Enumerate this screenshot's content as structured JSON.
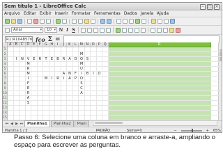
{
  "window": {
    "title": "Sem título 1 - LibreOffice Calc"
  },
  "menu": [
    "Arquivo",
    "Editar",
    "Exibir",
    "Inserir",
    "Formatar",
    "Ferramentas",
    "Dados",
    "Janela",
    "Ajuda"
  ],
  "formatting": {
    "font_name": "Arial",
    "font_size": "10",
    "bold": "N",
    "italic": "I",
    "underline": "S"
  },
  "formula_bar": {
    "name_box": "R1:R1048576",
    "function_wizard": "fco",
    "sum": "Σ",
    "equals": "="
  },
  "grid": {
    "columns": [
      "A",
      "B",
      "C",
      "D",
      "E",
      "F",
      "G",
      "H",
      "I",
      "J",
      "K",
      "L",
      "M",
      "N",
      "O",
      "P",
      "Q"
    ],
    "selected_column": "R",
    "rows": [
      "1",
      "2",
      "3",
      "4",
      "5",
      "6",
      "7",
      "8",
      "9",
      "10",
      "11",
      "12",
      "13",
      "14",
      "15"
    ],
    "cells": [
      {
        "row": "2",
        "col": "M",
        "text": "M"
      },
      {
        "row": "3",
        "col": "B",
        "text": "I"
      },
      {
        "row": "3",
        "col": "C",
        "text": "N"
      },
      {
        "row": "3",
        "col": "D",
        "text": "V"
      },
      {
        "row": "3",
        "col": "E",
        "text": "E"
      },
      {
        "row": "3",
        "col": "F",
        "text": "R"
      },
      {
        "row": "3",
        "col": "G",
        "text": "T"
      },
      {
        "row": "3",
        "col": "H",
        "text": "E"
      },
      {
        "row": "3",
        "col": "I",
        "text": "B"
      },
      {
        "row": "3",
        "col": "J",
        "text": "R"
      },
      {
        "row": "3",
        "col": "K",
        "text": "A"
      },
      {
        "row": "3",
        "col": "L",
        "text": "D"
      },
      {
        "row": "3",
        "col": "M",
        "text": "O"
      },
      {
        "row": "3",
        "col": "N",
        "text": "S"
      },
      {
        "row": "4",
        "col": "D",
        "text": "M"
      },
      {
        "row": "4",
        "col": "M",
        "text": "M"
      },
      {
        "row": "5",
        "col": "D",
        "text": "R"
      },
      {
        "row": "5",
        "col": "M",
        "text": "U"
      },
      {
        "row": "6",
        "col": "D",
        "text": "M"
      },
      {
        "row": "6",
        "col": "J",
        "text": "A"
      },
      {
        "row": "6",
        "col": "K",
        "text": "N"
      },
      {
        "row": "6",
        "col": "L",
        "text": "F"
      },
      {
        "row": "6",
        "col": "M",
        "text": "I"
      },
      {
        "row": "6",
        "col": "N",
        "text": "B"
      },
      {
        "row": "6",
        "col": "O",
        "text": "I"
      },
      {
        "row": "6",
        "col": "P",
        "text": "O"
      },
      {
        "row": "7",
        "col": "D",
        "text": "I"
      },
      {
        "row": "7",
        "col": "G",
        "text": "M"
      },
      {
        "row": "7",
        "col": "H",
        "text": "I"
      },
      {
        "row": "7",
        "col": "I",
        "text": "R"
      },
      {
        "row": "7",
        "col": "J",
        "text": "I"
      },
      {
        "row": "7",
        "col": "K",
        "text": "A"
      },
      {
        "row": "7",
        "col": "L",
        "text": "P"
      },
      {
        "row": "7",
        "col": "M",
        "text": "O"
      },
      {
        "row": "8",
        "col": "D",
        "text": "F"
      },
      {
        "row": "8",
        "col": "M",
        "text": "S"
      },
      {
        "row": "9",
        "col": "D",
        "text": "E"
      },
      {
        "row": "9",
        "col": "M",
        "text": "C"
      },
      {
        "row": "10",
        "col": "D",
        "text": "R"
      },
      {
        "row": "10",
        "col": "M",
        "text": "A"
      },
      {
        "row": "11",
        "col": "D",
        "text": "A"
      },
      {
        "row": "12",
        "col": "D",
        "text": "S"
      }
    ]
  },
  "sheet_tabs": [
    "Planilha1",
    "Planilha2",
    "Plani"
  ],
  "active_tab": "Planilha1",
  "status": {
    "sheet": "Planilha 1 / 3",
    "style": "PADRÃO",
    "sum": "Soma=0",
    "zoom": "65%"
  },
  "caption": "Passo 6: Selecione uma coluna em branco e arraste-a, ampliando o espaço para escrever as perguntas.",
  "colors": {
    "selection": "#7fbf3f",
    "selection_fill": "#c6e3b4"
  }
}
